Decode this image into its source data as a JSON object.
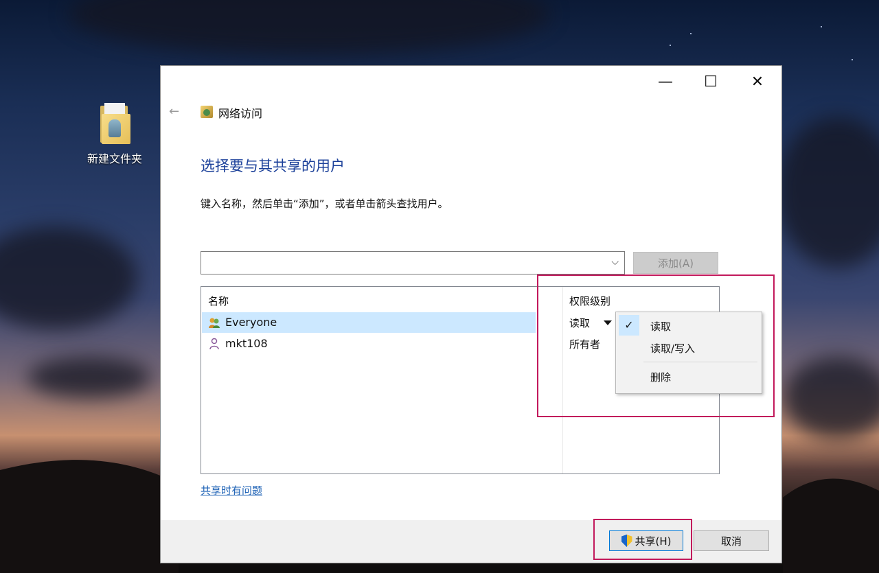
{
  "desktop": {
    "icon_label": "新建文件夹"
  },
  "window": {
    "title": "网络访问",
    "controls": {
      "minimize": "—",
      "maximize": "☐",
      "close": "✕"
    },
    "back_glyph": "←"
  },
  "content": {
    "heading": "选择要与其共享的用户",
    "instruction": "键入名称，然后单击“添加”，或者单击箭头查找用户。",
    "combo_value": "",
    "add_button": "添加(A)"
  },
  "table": {
    "columns": [
      "名称",
      "权限级别"
    ],
    "rows": [
      {
        "name": "Everyone",
        "permission": "读取",
        "selected": true
      },
      {
        "name": "mkt108",
        "permission": "所有者",
        "selected": false
      }
    ]
  },
  "context_menu": {
    "items": [
      {
        "label": "读取",
        "checked": true
      },
      {
        "label": "读取/写入",
        "checked": false
      },
      {
        "label": "删除",
        "checked": false
      }
    ],
    "check_glyph": "✓"
  },
  "help_link": "共享时有问题",
  "footer": {
    "share_button": "共享(H)",
    "cancel_button": "取消"
  },
  "colors": {
    "heading": "#1a3f99",
    "selection": "#cce8ff",
    "highlight_box": "#c2185b",
    "link": "#1a5fb4"
  }
}
